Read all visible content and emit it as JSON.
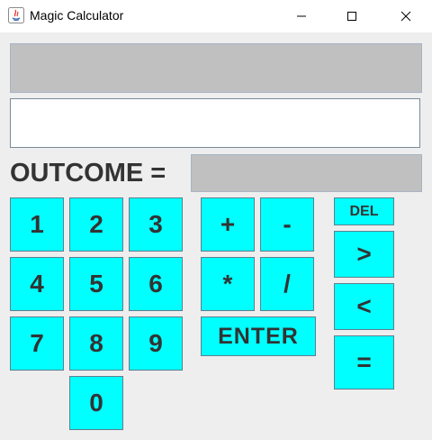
{
  "window": {
    "title": "Magic Calculator"
  },
  "outcome": {
    "label": "OUTCOME ="
  },
  "input": {
    "value": ""
  },
  "digits": {
    "d1": "1",
    "d2": "2",
    "d3": "3",
    "d4": "4",
    "d5": "5",
    "d6": "6",
    "d7": "7",
    "d8": "8",
    "d9": "9",
    "d0": "0"
  },
  "ops": {
    "plus": "+",
    "minus": "-",
    "times": "*",
    "divide": "/",
    "enter": "ENTER"
  },
  "controls": {
    "del": "DEL",
    "gt": ">",
    "lt": "<",
    "eq": "="
  },
  "colors": {
    "button_bg": "#00ffff",
    "display_bg": "#c0c0c0",
    "text": "#333333"
  }
}
